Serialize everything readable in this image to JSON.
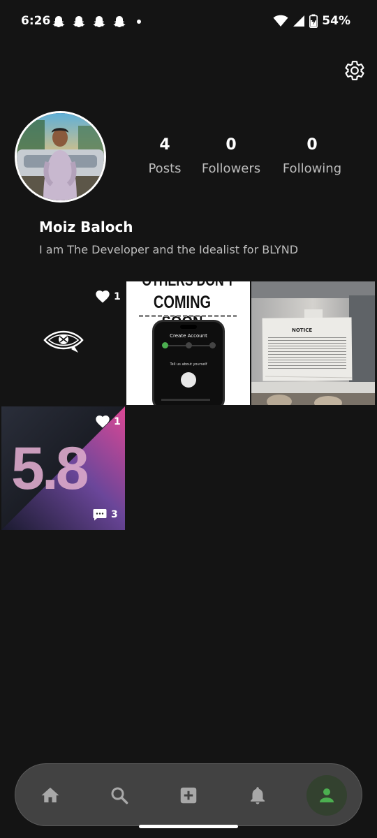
{
  "status_bar": {
    "time": "6:26",
    "battery": "54%",
    "notification_icons": [
      "snapchat-icon",
      "snapchat-icon",
      "snapchat-icon",
      "snapchat-icon"
    ]
  },
  "profile": {
    "name": "Moiz Baloch",
    "bio": "I am The Developer and the Idealist for BLYND",
    "stats": {
      "posts_value": "4",
      "posts_label": "Posts",
      "followers_value": "0",
      "followers_label": "Followers",
      "following_value": "0",
      "following_label": "Following"
    }
  },
  "posts": [
    {
      "kind": "blind-eye",
      "likes": "1"
    },
    {
      "kind": "coming-soon",
      "headline_top": "OTHERS DON'T",
      "headline": "COMING SOON",
      "screen_title": "Create Account",
      "screen_prompt": "Tell us about yourself"
    },
    {
      "kind": "notice-photo",
      "notice_title": "NOTICE"
    },
    {
      "kind": "version-graphic",
      "graphic_text": "5.8",
      "likes": "1",
      "comments": "3"
    }
  ],
  "nav": {
    "items": [
      "home-icon",
      "search-icon",
      "add-post-icon",
      "notifications-icon",
      "profile-icon"
    ],
    "active": "profile-icon"
  },
  "colors": {
    "background": "#141414",
    "nav_background": "#424242",
    "active_nav": "#4caf50",
    "secondary_text": "#bdbdbd"
  }
}
